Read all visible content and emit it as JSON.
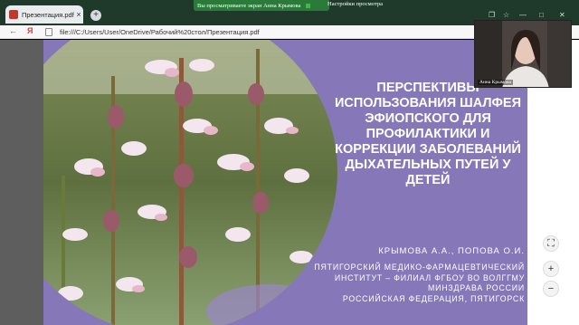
{
  "browser": {
    "tab_title": "Презентация.pdf",
    "tab_close": "×",
    "new_tab": "+",
    "back_icon": "←",
    "yandex_logo": "Я",
    "url": "file:///C:/Users/User/OneDrive/Рабочий%20стол/Презентация.pdf"
  },
  "screen_share": {
    "notice": "Вы просматриваете экран Анна Крымова",
    "settings_label": "Настройки просмотра"
  },
  "webcam": {
    "participant_name": "Анна Крымова"
  },
  "slide": {
    "title": "Перспективы использования шалфея эфиопского для профилактики и коррекции заболеваний дыхательных путей у детей",
    "authors": "Крымова А.А., Попова О.И.",
    "institution_lines": [
      "Пятигорский медико-фармацевтический",
      "институт – филиал ФГБОУ ВО ВолгГМУ",
      "Минздрава России",
      "Российская Федерация, Пятигорск"
    ]
  },
  "viewer_controls": {
    "fit_label": "⛶",
    "zoom_in_label": "+",
    "zoom_out_label": "−"
  },
  "colors": {
    "slide_bg": "#8577b8",
    "share_bar": "#2a7a3a"
  }
}
